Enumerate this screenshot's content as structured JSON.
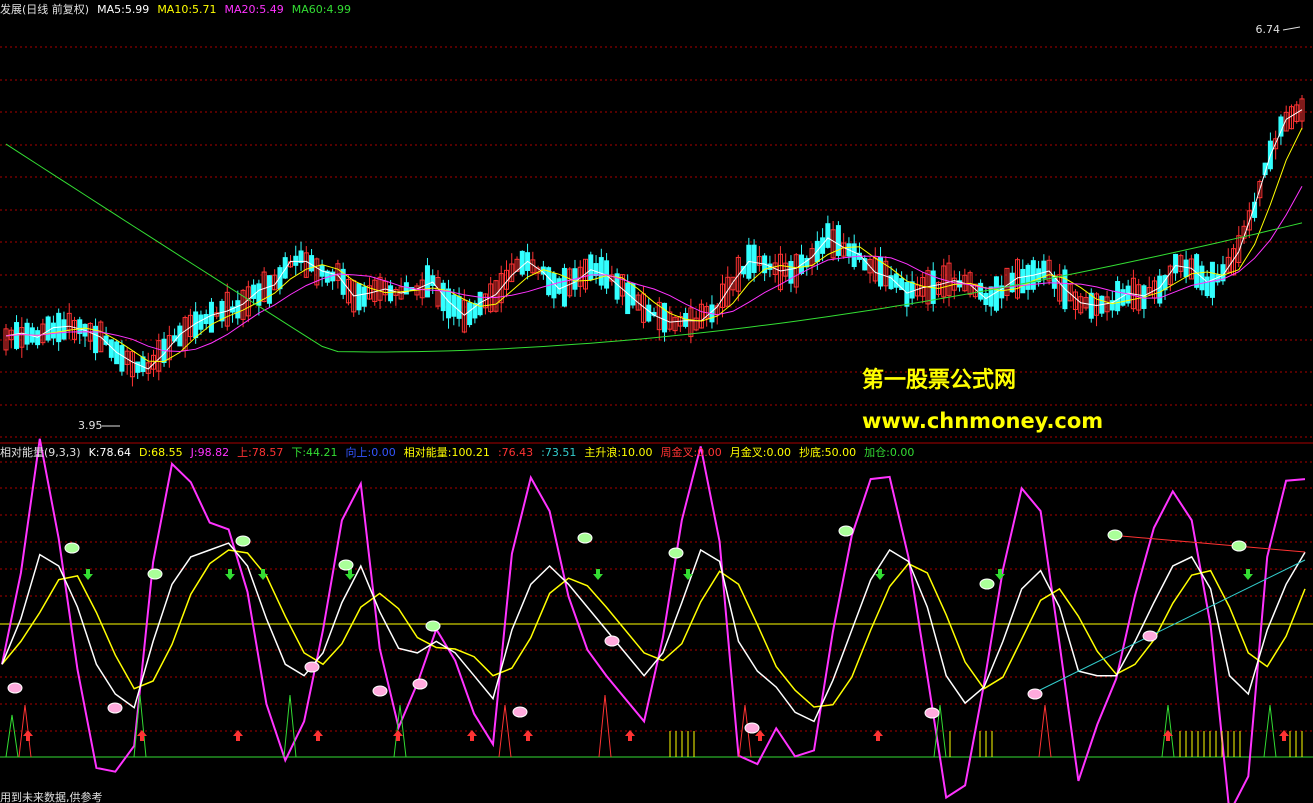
{
  "legend_top": [
    {
      "text": "发展(日线 前复权)",
      "color": "#e0e0e0"
    },
    {
      "text": "MA5:5.99",
      "color": "#ffffff"
    },
    {
      "text": "MA10:5.71",
      "color": "#ffff00"
    },
    {
      "text": "MA20:5.49",
      "color": "#ff33ff"
    },
    {
      "text": "MA60:4.99",
      "color": "#33dd33"
    }
  ],
  "legend_bottom": [
    {
      "text": "相对能量(9,3,3)",
      "color": "#e0e0e0"
    },
    {
      "text": "K:78.64",
      "color": "#ffffff"
    },
    {
      "text": "D:68.55",
      "color": "#ffff00"
    },
    {
      "text": "J:98.82",
      "color": "#ff33ff"
    },
    {
      "text": "上:78.57",
      "color": "#ff3333"
    },
    {
      "text": "下:44.21",
      "color": "#33dd33"
    },
    {
      "text": "向上:0.00",
      "color": "#3355ff"
    },
    {
      "text": "相对能量:100.21",
      "color": "#ffff00"
    },
    {
      "text": ":76.43",
      "color": "#ff3333"
    },
    {
      "text": ":73.51",
      "color": "#33cccc"
    },
    {
      "text": "主升浪:10.00",
      "color": "#ffff00"
    },
    {
      "text": "周金叉:0.00",
      "color": "#ff3333"
    },
    {
      "text": "月金叉:0.00",
      "color": "#ffff00"
    },
    {
      "text": "抄底:50.00",
      "color": "#ffff00"
    },
    {
      "text": "加仓:0.00",
      "color": "#33dd33"
    }
  ],
  "price_high_label": "6.74",
  "price_low_label": "3.95",
  "watermark": {
    "line1": "第一股票公式网",
    "line2": "www.chnmoney.com"
  },
  "footer_note": "用到未来数据,供参考",
  "colors": {
    "up": "#ff3333",
    "down": "#33ffff",
    "ma5": "#ffffff",
    "ma10": "#ffff00",
    "ma20": "#ff33ff",
    "ma60": "#33dd33",
    "grid": "#aa0000"
  },
  "chart_data": [
    {
      "type": "line",
      "series": [
        {
          "name": "MA5",
          "values": [
            4.51,
            4.53,
            4.5,
            4.57,
            4.58,
            4.55,
            4.5,
            4.39,
            4.32,
            4.27,
            4.38,
            4.52,
            4.6,
            4.66,
            4.69,
            4.74,
            4.84,
            4.88,
            5.05,
            5.05,
            4.98,
            4.95,
            4.8,
            4.82,
            4.85,
            4.82,
            4.85,
            4.9,
            4.76,
            4.66,
            4.75,
            4.81,
            4.95,
            5.05,
            4.97,
            4.85,
            4.9,
            4.99,
            4.95,
            4.85,
            4.75,
            4.66,
            4.61,
            4.62,
            4.62,
            4.72,
            4.9,
            5.05,
            5.03,
            4.98,
            5.0,
            5.08,
            5.22,
            5.15,
            5.1,
            4.97,
            4.93,
            4.82,
            4.86,
            4.88,
            4.91,
            4.88,
            4.78,
            4.85,
            4.93,
            4.95,
            4.98,
            4.85,
            4.75,
            4.73,
            4.75,
            4.82,
            4.8,
            4.86,
            5.02,
            5.0,
            4.9,
            4.95,
            5.12,
            5.45,
            5.82,
            6.08,
            6.15
          ]
        }
      ],
      "categories": [],
      "ylim": [
        3.9,
        6.8
      ]
    },
    {
      "type": "line",
      "series": [
        {
          "name": "K",
          "values": [
            35,
            55,
            83,
            78,
            60,
            35,
            22,
            16,
            45,
            70,
            82,
            85,
            88,
            78,
            55,
            35,
            30,
            40,
            62,
            78,
            58,
            42,
            40,
            45,
            40,
            30,
            20,
            50,
            70,
            78,
            70,
            60,
            50,
            40,
            30,
            40,
            62,
            85,
            80,
            45,
            32,
            25,
            14,
            10,
            28,
            50,
            72,
            85,
            80,
            60,
            30,
            18,
            25,
            45,
            68,
            76,
            60,
            32,
            30,
            30,
            45,
            62,
            78,
            82,
            68,
            30,
            22,
            50,
            70,
            84
          ]
        }
      ],
      "categories": [],
      "ylim": [
        0,
        100
      ]
    }
  ]
}
